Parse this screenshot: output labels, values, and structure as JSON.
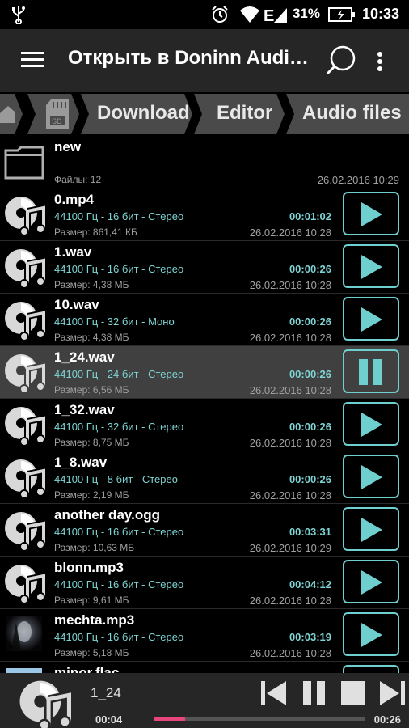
{
  "status_bar": {
    "battery": "31%",
    "time": "10:33",
    "icons": [
      "usb-icon",
      "alarm-icon",
      "wifi-icon",
      "signal-icon",
      "battery-charging-icon"
    ]
  },
  "app_bar": {
    "title": "Открыть в Doninn Audi…",
    "icons": [
      "menu-icon",
      "search-icon",
      "more-vert-icon"
    ]
  },
  "breadcrumb": {
    "items": [
      "Download",
      "Editor",
      "Audio files"
    ]
  },
  "colors": {
    "accent": "#6fcfcf",
    "info_text": "#7ed4d4",
    "progress": "#e8457a",
    "selected_row": "#404040"
  },
  "files": [
    {
      "name": "new",
      "size": "Файлы: 12",
      "date": "26.02.2016 10:29",
      "type": "folder"
    },
    {
      "name": "0.mp4",
      "info": "44100 Гц - 16 бит - Стерео",
      "duration": "00:01:02",
      "size": "Размер: 861,41 КБ",
      "date": "26.02.2016 10:28",
      "type": "audio",
      "state": "play"
    },
    {
      "name": "1.wav",
      "info": "44100 Гц - 16 бит - Стерео",
      "duration": "00:00:26",
      "size": "Размер: 4,38 МБ",
      "date": "26.02.2016 10:28",
      "type": "audio",
      "state": "play"
    },
    {
      "name": "10.wav",
      "info": "44100 Гц - 32 бит - Моно",
      "duration": "00:00:26",
      "size": "Размер: 4,38 МБ",
      "date": "26.02.2016 10:28",
      "type": "audio",
      "state": "play"
    },
    {
      "name": "1_24.wav",
      "info": "44100 Гц - 24 бит - Стерео",
      "duration": "00:00:26",
      "size": "Размер: 6,56 МБ",
      "date": "26.02.2016 10:28",
      "type": "audio",
      "state": "pause",
      "selected": true
    },
    {
      "name": "1_32.wav",
      "info": "44100 Гц - 32 бит - Стерео",
      "duration": "00:00:26",
      "size": "Размер: 8,75 МБ",
      "date": "26.02.2016 10:28",
      "type": "audio",
      "state": "play"
    },
    {
      "name": "1_8.wav",
      "info": "44100 Гц - 8 бит - Стерео",
      "duration": "00:00:26",
      "size": "Размер: 2,19 МБ",
      "date": "26.02.2016 10:28",
      "type": "audio",
      "state": "play"
    },
    {
      "name": "another day.ogg",
      "info": "44100 Гц - 16 бит - Стерео",
      "duration": "00:03:31",
      "size": "Размер: 10,63 МБ",
      "date": "26.02.2016 10:29",
      "type": "audio",
      "state": "play"
    },
    {
      "name": "blonn.mp3",
      "info": "44100 Гц - 16 бит - Стерео",
      "duration": "00:04:12",
      "size": "Размер: 9,61 МБ",
      "date": "26.02.2016 10:28",
      "type": "audio",
      "state": "play"
    },
    {
      "name": "mechta.mp3",
      "info": "44100 Гц - 16 бит - Стерео",
      "duration": "00:03:19",
      "size": "Размер: 5,18 МБ",
      "date": "26.02.2016 10:28",
      "type": "audio",
      "state": "play",
      "thumbnail": true
    },
    {
      "name": "minor.flac",
      "info": "",
      "duration": "",
      "size": "",
      "date": "",
      "type": "audio",
      "state": "play",
      "thumbnail": true
    }
  ],
  "player": {
    "track": "1_24",
    "elapsed": "00:04",
    "total": "00:26",
    "progress_fraction": 0.15
  }
}
